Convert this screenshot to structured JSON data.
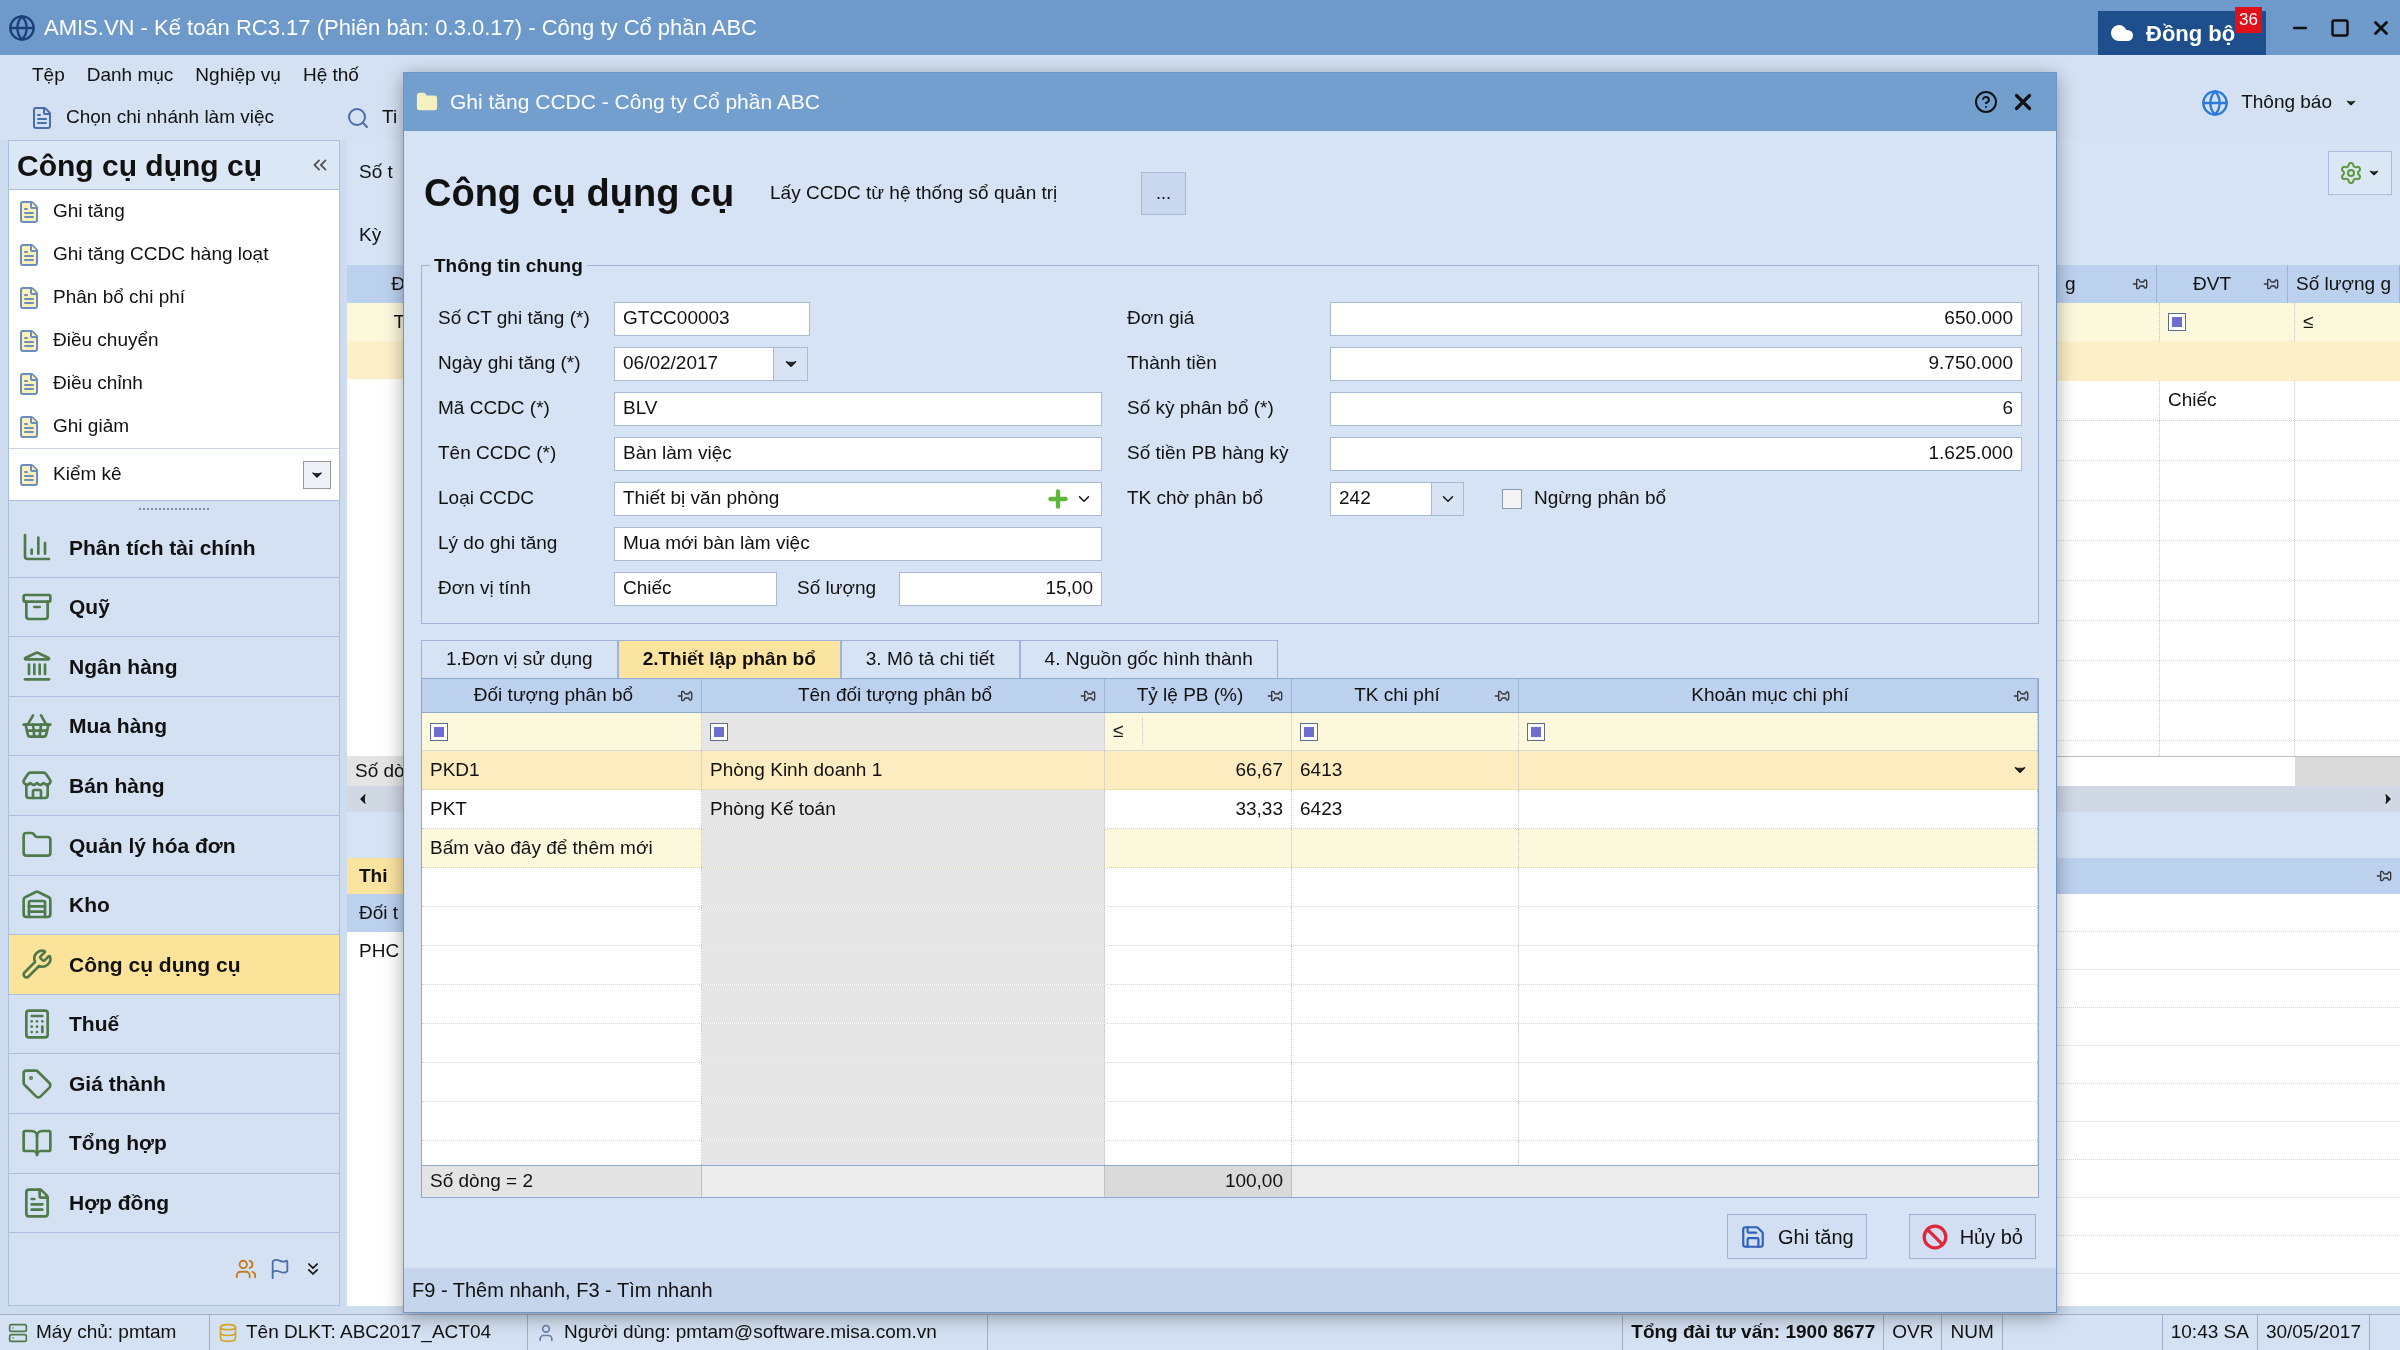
{
  "window": {
    "title": "AMIS.VN - Kế toán RC3.17 (Phiên bản: 0.3.0.17) - Công ty Cổ phần ABC",
    "sync_label": "Đồng bộ",
    "sync_badge": "36"
  },
  "menu": [
    "Tệp",
    "Danh mục",
    "Nghiệp vụ",
    "Hệ thố"
  ],
  "toolbar": {
    "branch_label": "Chọn chi nhánh làm việc",
    "search_label": "Ti",
    "notification_label": "Thông báo"
  },
  "sidebar": {
    "title": "Công cụ dụng cụ",
    "tasks": [
      "Ghi tăng",
      "Ghi tăng CCDC hàng loạt",
      "Phân bổ chi phí",
      "Điều chuyển",
      "Điều chỉnh",
      "Ghi giảm"
    ],
    "extra_task": "Kiểm kê",
    "modules": [
      {
        "label": "Phân tích tài chính",
        "selected": false
      },
      {
        "label": "Quỹ",
        "selected": false
      },
      {
        "label": "Ngân hàng",
        "selected": false
      },
      {
        "label": "Mua hàng",
        "selected": false
      },
      {
        "label": "Bán hàng",
        "selected": false
      },
      {
        "label": "Quản lý hóa đơn",
        "selected": false
      },
      {
        "label": "Kho",
        "selected": false
      },
      {
        "label": "Công cụ dụng cụ",
        "selected": true
      },
      {
        "label": "Thuế",
        "selected": false
      },
      {
        "label": "Giá thành",
        "selected": false
      },
      {
        "label": "Tổng hợp",
        "selected": false
      },
      {
        "label": "Hợp đồng",
        "selected": false
      }
    ]
  },
  "main_left_edge": {
    "label_1": "Số t",
    "label_2": "Kỳ",
    "grid_header": "Đ",
    "grid_row": "T",
    "grid_footer": "Số dò",
    "detail_tab": "Thi",
    "detail_header": "Đối t",
    "detail_row": "PHC"
  },
  "main_right_edge": {
    "columns": [
      "g",
      "ĐVT",
      "Số lượng g"
    ],
    "filter_operator": "≤",
    "row_unit": "Chiếc"
  },
  "dialog": {
    "title": "Ghi tăng CCDC - Công ty Cổ phần ABC",
    "heading": "Công cụ dụng cụ",
    "source_label": "Lấy CCDC từ hệ thống sổ quản trị",
    "source_button": "...",
    "group_title": "Thông tin chung",
    "left_fields": [
      {
        "kind": "short",
        "label": "Số CT ghi tăng (*)",
        "value": "GTCC00003"
      },
      {
        "kind": "date",
        "label": "Ngày ghi tăng (*)",
        "value": "06/02/2017"
      },
      {
        "kind": "text",
        "label": "Mã CCDC (*)",
        "value": "BLV"
      },
      {
        "kind": "text",
        "label": "Tên CCDC (*)",
        "value": "Bàn làm việc"
      },
      {
        "kind": "combo_add",
        "label": "Loại CCDC",
        "value": "Thiết bị văn phòng"
      },
      {
        "kind": "text",
        "label": "Lý do ghi tăng",
        "value": "Mua mới bàn làm việc"
      }
    ],
    "unit_row": {
      "label": "Đơn vị tính",
      "value": "Chiếc",
      "quantity_label": "Số lượng",
      "quantity_value": "15,00"
    },
    "right_fields": [
      {
        "kind": "number",
        "label": "Đơn giá",
        "value": "650.000"
      },
      {
        "kind": "number",
        "label": "Thành tiền",
        "value": "9.750.000"
      },
      {
        "kind": "number",
        "label": "Số kỳ phân bổ (*)",
        "value": "6"
      },
      {
        "kind": "number",
        "label": "Số tiền PB hàng kỳ",
        "value": "1.625.000"
      },
      {
        "kind": "select",
        "label": "TK chờ phân bổ",
        "value": "242"
      }
    ],
    "stop_checkbox": {
      "label": "Ngừng phân bổ",
      "checked": false
    },
    "tabs": [
      {
        "label": "1.Đơn vị sử dụng",
        "selected": false
      },
      {
        "label": "2.Thiết lập phân bổ",
        "selected": true
      },
      {
        "label": "3. Mô tả chi tiết",
        "selected": false
      },
      {
        "label": "4. Nguồn gốc hình thành",
        "selected": false
      }
    ],
    "grid": {
      "columns": [
        {
          "label": "Đối tượng phân bổ",
          "kind": "box"
        },
        {
          "label": "Tên đối tượng phân bổ",
          "kind": "box"
        },
        {
          "label": "Tỷ lệ PB (%)",
          "kind": "operator",
          "filter_text": "≤"
        },
        {
          "label": "TK chi phí",
          "kind": "box"
        },
        {
          "label": "Khoản mục chi phí",
          "kind": "box"
        }
      ],
      "rows": [
        {
          "code": "PKD1",
          "name": "Phòng Kinh doanh 1",
          "ratio": "66,67",
          "account": "6413",
          "selected": true
        },
        {
          "code": "PKT",
          "name": "Phòng Kế toán",
          "ratio": "33,33",
          "account": "6423",
          "selected": false
        }
      ],
      "new_row_hint": "Bấm vào đây để thêm mới",
      "footer_count": "Số dòng = 2",
      "footer_total": "100,00"
    },
    "buttons": [
      {
        "kind": "save",
        "label": "Ghi tăng"
      },
      {
        "kind": "cancel",
        "label": "Hủy bỏ"
      }
    ],
    "hint": "F9 - Thêm nhanh, F3 - Tìm nhanh"
  },
  "status_bar": {
    "server": "Máy chủ: pmtam",
    "database": "Tên DLKT: ABC2017_ACT04",
    "user": "Người dùng: pmtam@software.misa.com.vn",
    "hotline": "Tổng đài tư vấn: 1900 8677",
    "ovr": "OVR",
    "num": "NUM",
    "time": "10:43 SA",
    "date": "30/05/2017"
  }
}
